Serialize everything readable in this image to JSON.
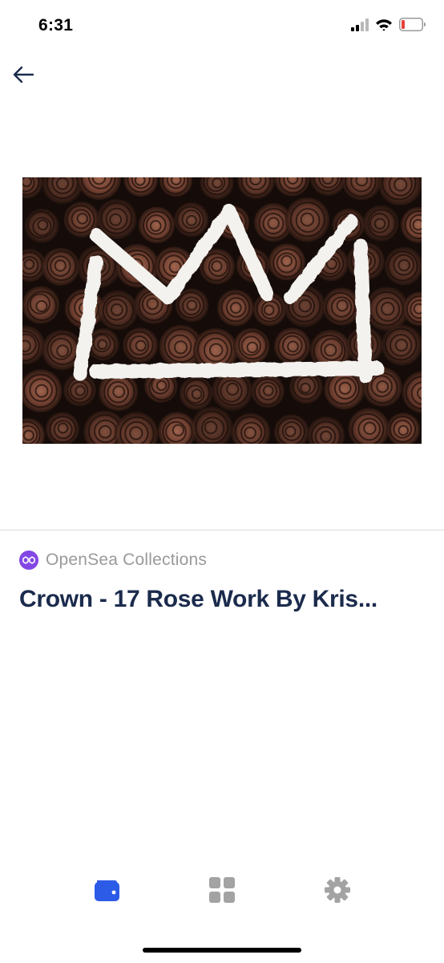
{
  "status_bar": {
    "time": "6:31",
    "icons": [
      "cellular-signal-icon",
      "wifi-icon",
      "battery-low-icon"
    ]
  },
  "nav": {
    "back_icon": "arrow-left-icon"
  },
  "nft": {
    "artwork_icon": "crown-artwork-image",
    "collection_icon": "polygon-icon",
    "collection_name": "OpenSea Collections",
    "title": "Crown - 17 Rose Work By Kris..."
  },
  "tab_bar": {
    "items": [
      {
        "icon": "wallet-icon",
        "active": true
      },
      {
        "icon": "grid-icon",
        "active": false
      },
      {
        "icon": "gear-icon",
        "active": false
      }
    ],
    "active_color": "#2c5be8",
    "inactive_color": "#a3a3a3"
  },
  "colors": {
    "title": "#1b2b4d",
    "collection_name": "#9a9a9a",
    "polygon": "#8247e5",
    "battery_low": "#e8413a"
  }
}
